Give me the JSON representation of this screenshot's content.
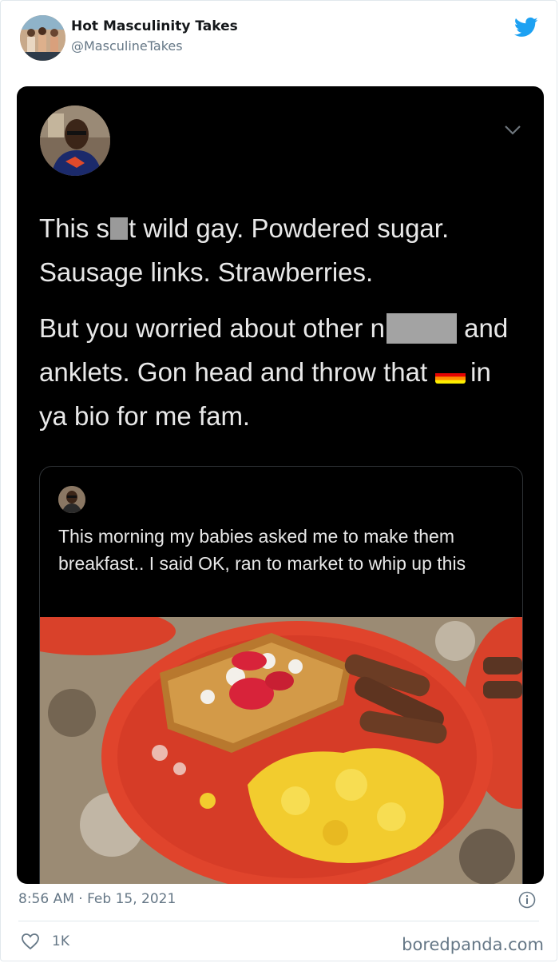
{
  "author": {
    "name": "Hot Masculinity Takes",
    "handle": "@MasculineTakes"
  },
  "screenshot": {
    "line1_pre": "This s",
    "line1_post": "t wild gay. Powdered sugar. Sausage links. Strawberries.",
    "line2_pre": "But you worried about other n",
    "line2_mid": "and anklets. Gon head and throw that",
    "line2_post": "in ya bio for me fam.",
    "quoted_text": "This morning my babies asked me to make them breakfast.. I said OK, ran to market to whip up this"
  },
  "meta": {
    "time": "8:56 AM · Feb 15, 2021",
    "likes": "1K",
    "source": "boredpanda.com"
  },
  "colors": {
    "twitter_blue": "#1da1f2",
    "meta_gray": "#657786",
    "border": "#e1e8ed",
    "dark_bg": "#000000"
  },
  "icons": [
    "twitter-bird-icon",
    "chevron-down-icon",
    "info-icon",
    "heart-icon",
    "rainbow-flag-icon"
  ]
}
